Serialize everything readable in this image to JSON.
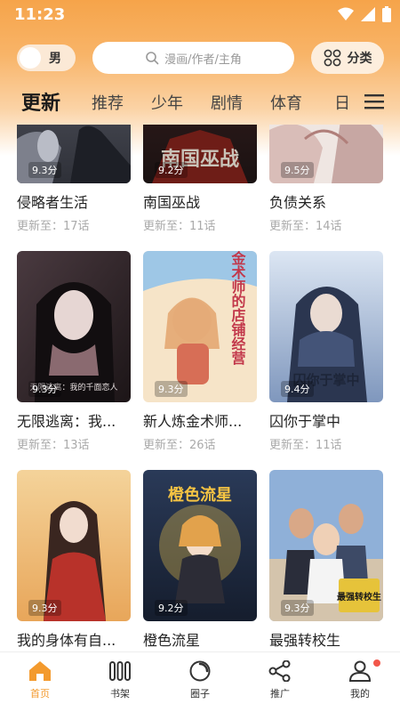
{
  "status_bar": {
    "time": "11:23"
  },
  "top_bar": {
    "gender": "男",
    "search_placeholder": "漫画/作者/主角",
    "category_label": "分类"
  },
  "tabs": [
    {
      "label": "更新",
      "active": true
    },
    {
      "label": "推荐"
    },
    {
      "label": "少年"
    },
    {
      "label": "剧情"
    },
    {
      "label": "体育"
    },
    {
      "label": "日"
    }
  ],
  "comics": [
    {
      "title": "侵略者生活",
      "update": "更新至：17话",
      "score": "9.3分",
      "cover_colors": [
        "#3b3d45",
        "#9a9ca6"
      ]
    },
    {
      "title": "南国巫战",
      "update": "更新至：11话",
      "score": "9.2分",
      "cover_colors": [
        "#2a1e1e",
        "#8c2c24"
      ],
      "cover_text": "南国巫战"
    },
    {
      "title": "负债关系",
      "update": "更新至：14话",
      "score": "9.5分",
      "cover_colors": [
        "#e8ddd8",
        "#c9a9a6"
      ]
    },
    {
      "title": "无限逃离：我...",
      "update": "更新至：13话",
      "score": "9.3分",
      "cover_colors": [
        "#2b2326",
        "#7a5a61"
      ],
      "cover_text": "无限逃离：我的千面恋人"
    },
    {
      "title": "新人炼金术师...",
      "update": "更新至：26话",
      "score": "9.3分",
      "cover_colors": [
        "#f3d9b8",
        "#d98c5a"
      ],
      "cover_text": "新人炼金术师的店铺经营"
    },
    {
      "title": "囚你于掌中",
      "update": "更新至：11话",
      "score": "9.4分",
      "cover_colors": [
        "#8fa6c8",
        "#d9e3f1"
      ],
      "cover_text": "囚你于掌中"
    },
    {
      "title": "我的身体有自...",
      "update": "",
      "score": "9.3分",
      "cover_colors": [
        "#f1c27a",
        "#b33b2a"
      ]
    },
    {
      "title": "橙色流星",
      "update": "",
      "score": "9.2分",
      "cover_colors": [
        "#1f2d44",
        "#e9b640"
      ],
      "cover_text": "橙色流星"
    },
    {
      "title": "最强转校生",
      "update": "",
      "score": "9.3分",
      "cover_colors": [
        "#4b78b8",
        "#d8c9b2"
      ],
      "cover_text": "最强转校生"
    }
  ],
  "bottom_nav": [
    {
      "label": "首页",
      "icon": "home-icon",
      "active": true
    },
    {
      "label": "书架",
      "icon": "bookshelf-icon"
    },
    {
      "label": "圈子",
      "icon": "circle-icon"
    },
    {
      "label": "推广",
      "icon": "share-icon"
    },
    {
      "label": "我的",
      "icon": "profile-icon",
      "badge": true
    }
  ],
  "colors": {
    "accent": "#f39a2e",
    "header_orange": "#f6a44a",
    "badge_red": "#f2564a"
  }
}
